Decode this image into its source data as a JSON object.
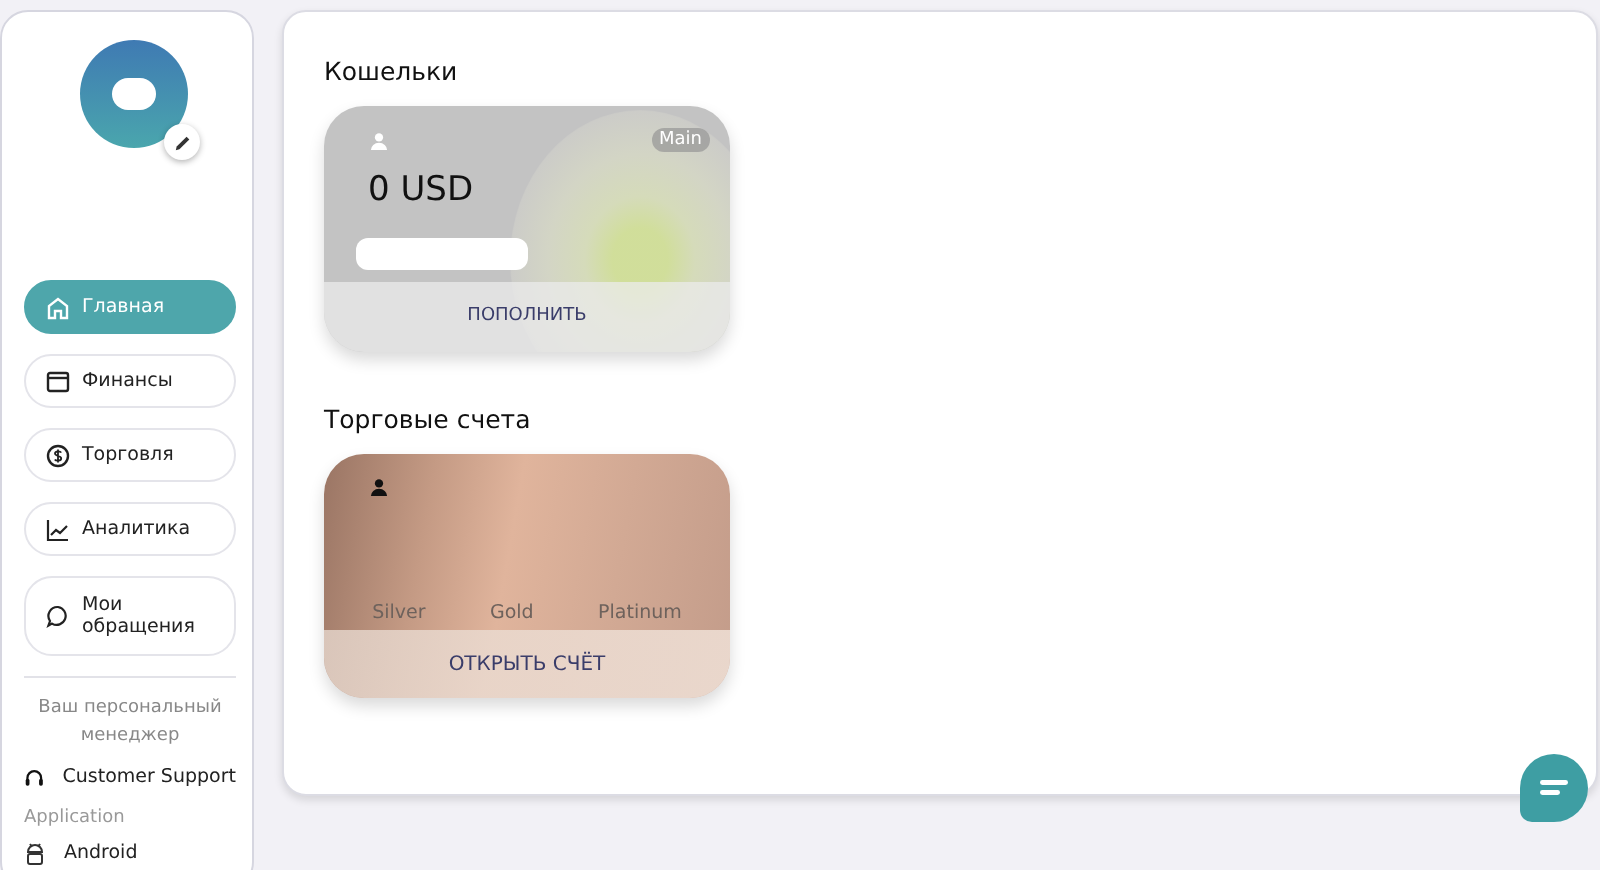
{
  "sidebar": {
    "nav": [
      {
        "kind": "home",
        "label": "Главная",
        "selected": true
      },
      {
        "kind": "calendar",
        "label": "Финансы",
        "selected": false
      },
      {
        "kind": "dollar",
        "label": "Торговля",
        "selected": false
      },
      {
        "kind": "chart",
        "label": "Аналитика",
        "selected": false
      },
      {
        "kind": "chat",
        "label": "Мои обращения",
        "selected": false
      }
    ],
    "manager_label": "Ваш персональный менеджер",
    "support": "Customer Support",
    "app_label": "Application",
    "app": "Android"
  },
  "wallets": {
    "title": "Кошельки",
    "card": {
      "amount": "0 USD",
      "badge": "Main",
      "action": "ПОПОЛНИТЬ"
    }
  },
  "trading": {
    "title": "Торговые счета",
    "card": {
      "tiers": [
        "Silver",
        "Gold",
        "Platinum"
      ],
      "action": "ОТКРЫТЬ СЧЁТ"
    }
  }
}
